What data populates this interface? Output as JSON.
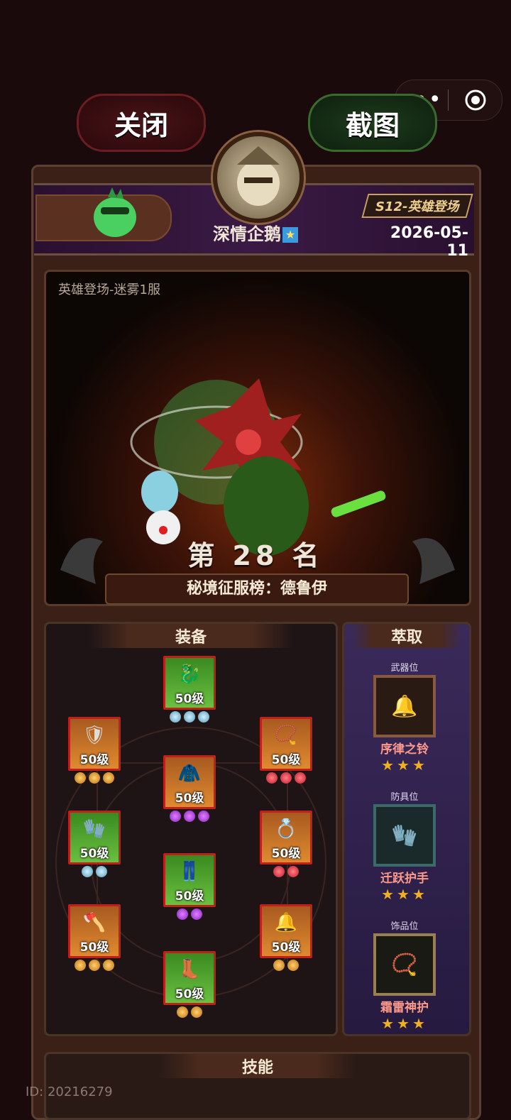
{
  "top_bar": {
    "more_icon": "more-dots-icon",
    "target_icon": "target-icon"
  },
  "buttons": {
    "close": "关闭",
    "screenshot": "截图"
  },
  "profile": {
    "nickname": "深情企鹅",
    "season": "S12-英雄登场",
    "date": "2026-05-11"
  },
  "hero": {
    "server": "英雄登场-迷雾1服",
    "rank": "第 28 名",
    "ranklist": "秘境征服榜：德鲁伊"
  },
  "equipment": {
    "title": "装备",
    "level_label": "50级",
    "slots": [
      {
        "level": "50级",
        "color": "green",
        "gems": [
          "blue",
          "blue",
          "blue"
        ],
        "icon": "dragon-helm-icon"
      },
      {
        "level": "50级",
        "color": "orange",
        "gems": [
          "gold",
          "gold",
          "gold"
        ],
        "icon": "shoulder-icon"
      },
      {
        "level": "50级",
        "color": "orange",
        "gems": [
          "red",
          "red",
          "red"
        ],
        "icon": "necklace-icon"
      },
      {
        "level": "50级",
        "color": "orange",
        "gems": [
          "purple",
          "purple",
          "purple"
        ],
        "icon": "armor-icon"
      },
      {
        "level": "50级",
        "color": "green",
        "gems": [
          "blue",
          "blue"
        ],
        "icon": "gauntlet-icon"
      },
      {
        "level": "50级",
        "color": "orange",
        "gems": [
          "red",
          "red"
        ],
        "icon": "ring-icon"
      },
      {
        "level": "50级",
        "color": "green",
        "gems": [
          "purple",
          "purple"
        ],
        "icon": "pants-icon"
      },
      {
        "level": "50级",
        "color": "orange",
        "gems": [
          "gold",
          "gold",
          "gold"
        ],
        "icon": "axe-icon"
      },
      {
        "level": "50级",
        "color": "orange",
        "gems": [
          "gold",
          "gold"
        ],
        "icon": "bell-icon"
      },
      {
        "level": "50级",
        "color": "green",
        "gems": [
          "gold",
          "gold"
        ],
        "icon": "boots-icon"
      }
    ]
  },
  "extract": {
    "title": "萃取",
    "slots": [
      {
        "label": "武器位",
        "name": "序律之铃",
        "stars": 3,
        "icon": "bell-wand-icon"
      },
      {
        "label": "防具位",
        "name": "迁跃护手",
        "stars": 3,
        "icon": "gauntlet-icon"
      },
      {
        "label": "饰品位",
        "name": "霜雷神护",
        "stars": 3,
        "icon": "amulet-icon"
      }
    ]
  },
  "skill": {
    "title": "技能"
  },
  "footer": {
    "id": "ID: 20216279"
  },
  "colors": {
    "background": "#1a0a0c",
    "accent_gold": "#f0b020",
    "extract_name": "#ff9a8a"
  }
}
